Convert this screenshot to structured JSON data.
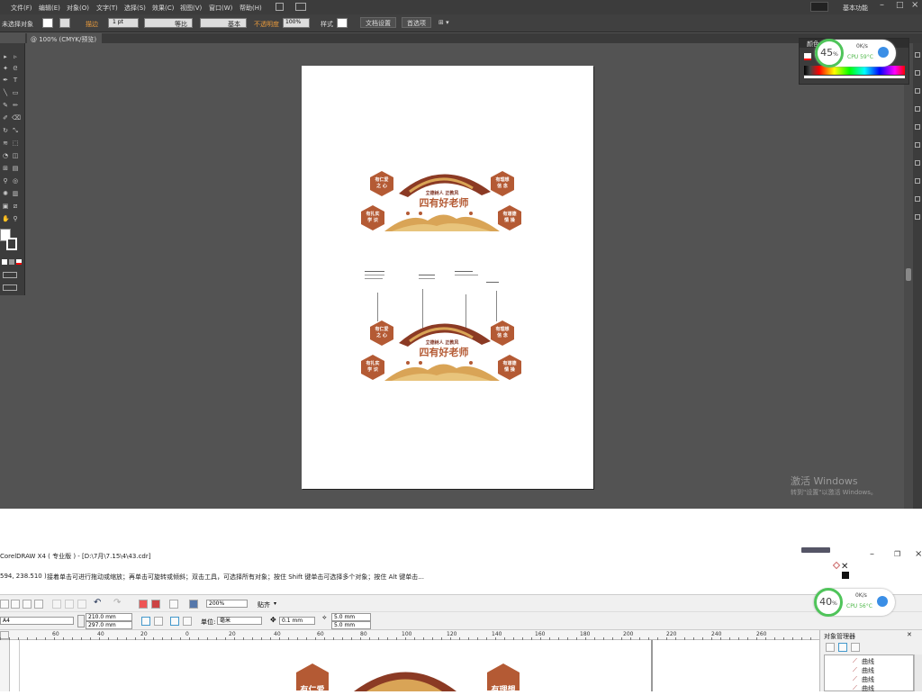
{
  "ai": {
    "menu": [
      "文件(F)",
      "编辑(E)",
      "对象(O)",
      "文字(T)",
      "选择(S)",
      "效果(C)",
      "视图(V)",
      "窗口(W)",
      "帮助(H)"
    ],
    "workspace": "基本功能",
    "control": {
      "no_selection": "未选择对象",
      "stroke_label": "描边",
      "stroke_value": "1 pt",
      "profile_label": "等比",
      "brush_label": "基本",
      "opacity_label": "不透明度",
      "opacity_value": "100%",
      "style_label": "样式",
      "doc_setup": "文档设置",
      "prefs": "首选项"
    },
    "tab_label": "@ 100% (CMYK/预览)",
    "color_panel_title": "颜色"
  },
  "monitor_top": {
    "percent": "45",
    "unit": "%",
    "speed": "0K/s",
    "cpu": "CPU 59°C"
  },
  "monitor_bottom": {
    "percent": "40",
    "unit": "%",
    "speed": "0K/s",
    "cpu": "CPU 56°C"
  },
  "activation": {
    "title": "激活 Windows",
    "subtitle": "转到\"设置\"以激活 Windows。"
  },
  "design": {
    "title": "四有好老师",
    "subtitle": "立德树人 正教风",
    "hex_tl": [
      "有仁爱",
      "之 心"
    ],
    "hex_bl": [
      "有扎实",
      "学 识"
    ],
    "hex_tr": [
      "有理想",
      "信 念"
    ],
    "hex_br": [
      "有道德",
      "情 操"
    ]
  },
  "cdr": {
    "title": "CorelDRAW X4 ( 专业版 ) - [D:\\7月\\7.15\\4\\43.cdr]",
    "coords": "594, 238.510 )",
    "status": "接着单击可进行拖动或缩放；再单击可旋转或倾斜；双击工具，可选择所有对象；按住 Shift 键单击可选择多个对象；按住 Alt 键单击...",
    "zoom": "200%",
    "snap": "贴齐",
    "paper": "A4",
    "width": "210.0 mm",
    "height": "297.0 mm",
    "unit_label": "单位:",
    "unit": "毫米",
    "nudge": "0.1 mm",
    "dup_x": "5.0 mm",
    "dup_y": "5.0 mm",
    "ruler_ticks": [
      "60",
      "40",
      "20",
      "0",
      "20",
      "40",
      "60",
      "80",
      "100",
      "120",
      "140",
      "160",
      "180",
      "200",
      "220",
      "240",
      "260"
    ],
    "docker_title": "对象管理器",
    "docker_items": [
      "曲线",
      "曲线",
      "曲线",
      "曲线"
    ],
    "hex_left": "有仁爱",
    "hex_right": "有理想"
  },
  "colors": {
    "hex": "#b45a34",
    "dark": "#7b2e1f",
    "gold": "#d9a456",
    "arch": "#8b3a24"
  }
}
